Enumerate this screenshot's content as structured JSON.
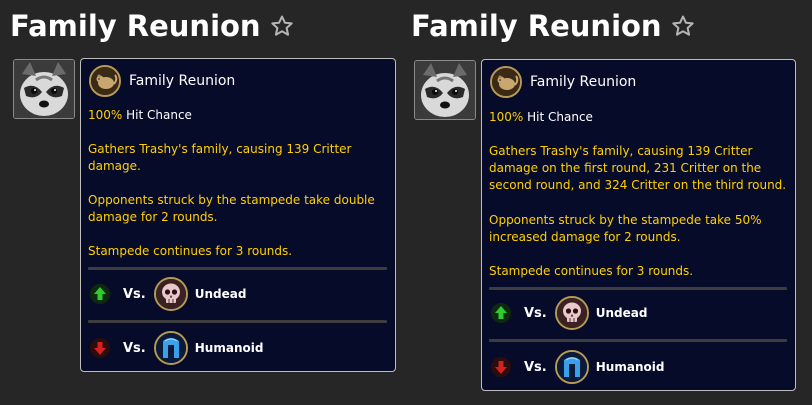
{
  "tooltips": [
    {
      "page_title": "Family Reunion",
      "ability_name": "Family Reunion",
      "hit_chance_value": "100%",
      "hit_chance_label": "Hit Chance",
      "desc1_line1": "Gathers Trashy's family, causing 139 Critter",
      "desc1_line2": "damage.",
      "desc1_line3": "",
      "desc2_line1": "Opponents struck by the stampede take double",
      "desc2_line2": "damage for 2 rounds.",
      "desc3": "Stampede continues for 3 rounds.",
      "strong": {
        "vs": "Vs.",
        "type": "Undead"
      },
      "weak": {
        "vs": "Vs.",
        "type": "Humanoid"
      }
    },
    {
      "page_title": "Family Reunion",
      "ability_name": "Family Reunion",
      "hit_chance_value": "100%",
      "hit_chance_label": "Hit Chance",
      "desc1_line1": "Gathers Trashy's family, causing 139 Critter",
      "desc1_line2": "damage on the first round, 231 Critter on the",
      "desc1_line3": "second round, and 324 Critter on the third round.",
      "desc2_line1": "Opponents struck by the stampede take 50%",
      "desc2_line2": "increased damage for 2 rounds.",
      "desc3": "Stampede continues for 3 rounds.",
      "strong": {
        "vs": "Vs.",
        "type": "Undead"
      },
      "weak": {
        "vs": "Vs.",
        "type": "Humanoid"
      }
    }
  ],
  "icons": {
    "favorite": "star-outline-icon",
    "pet_portrait": "raccoon-portrait-icon",
    "ability": "critter-stampede-icon",
    "strong_arrow": "green-up-arrow-icon",
    "weak_arrow": "red-down-arrow-icon",
    "undead": "skull-icon",
    "humanoid": "helmet-icon"
  },
  "colors": {
    "text_gold": "#ffd100",
    "card_bg": "#070b2a",
    "page_bg": "#262626"
  }
}
